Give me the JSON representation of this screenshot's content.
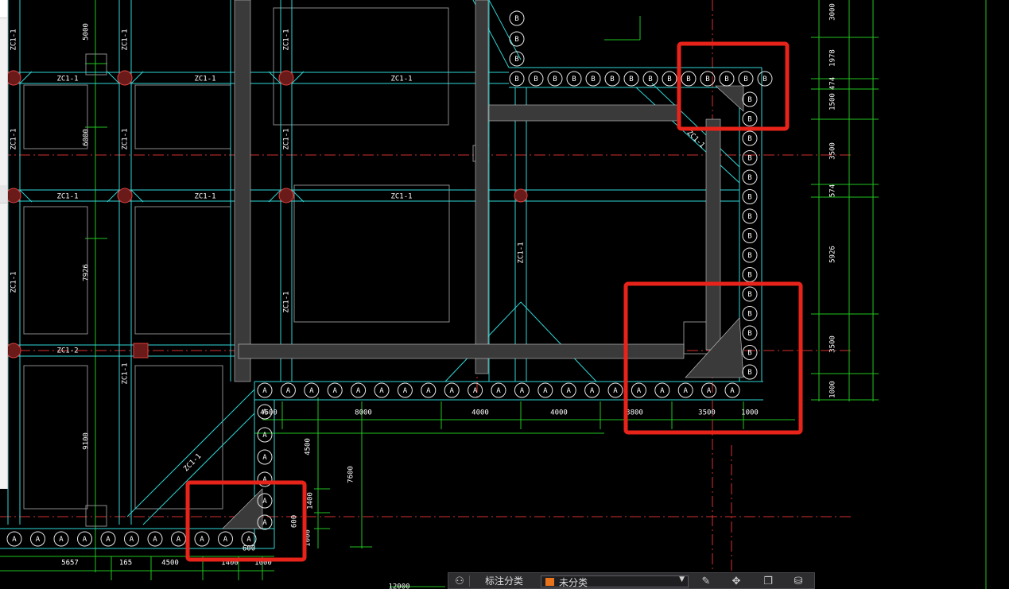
{
  "drawing": {
    "beam_labels": [
      "ZC1-1",
      "ZC1-1",
      "ZC1-1",
      "ZC1-1",
      "ZC1-1",
      "ZC1-1",
      "ZC1-1",
      "ZC1-1",
      "ZC1-1",
      "ZC1-1",
      "ZC1-1",
      "ZC1-1",
      "ZC1-2",
      "ZC1-1",
      "ZC1-1",
      "ZC1-1",
      "ZC1-1",
      "ZC1-1"
    ],
    "pile_A_label": "A",
    "pile_B_label": "B",
    "dim_right": [
      "3000",
      "1978",
      "474",
      "1500",
      "3500",
      "574",
      "5926",
      "3500",
      "1000"
    ],
    "dim_bottom": [
      "4500",
      "8000",
      "4000",
      "4000",
      "3800",
      "3500",
      "1000"
    ],
    "dim_bottom_left": [
      "5657",
      "165",
      "4500",
      "1400",
      "1000"
    ],
    "dim_left_vertical": [
      "5000",
      "6000",
      "7926",
      "9100"
    ],
    "dim_lower_vertical": [
      "4500",
      "7600",
      "1400",
      "600",
      "1000"
    ],
    "dim_misc": [
      "600",
      "12000"
    ]
  },
  "toolbar": {
    "label": "标注分类",
    "select_value": "未分类",
    "select_color": "#e8731a",
    "icons": [
      "annotation-icon",
      "edit-icon",
      "move-icon",
      "copy-icon",
      "stack-icon"
    ]
  }
}
